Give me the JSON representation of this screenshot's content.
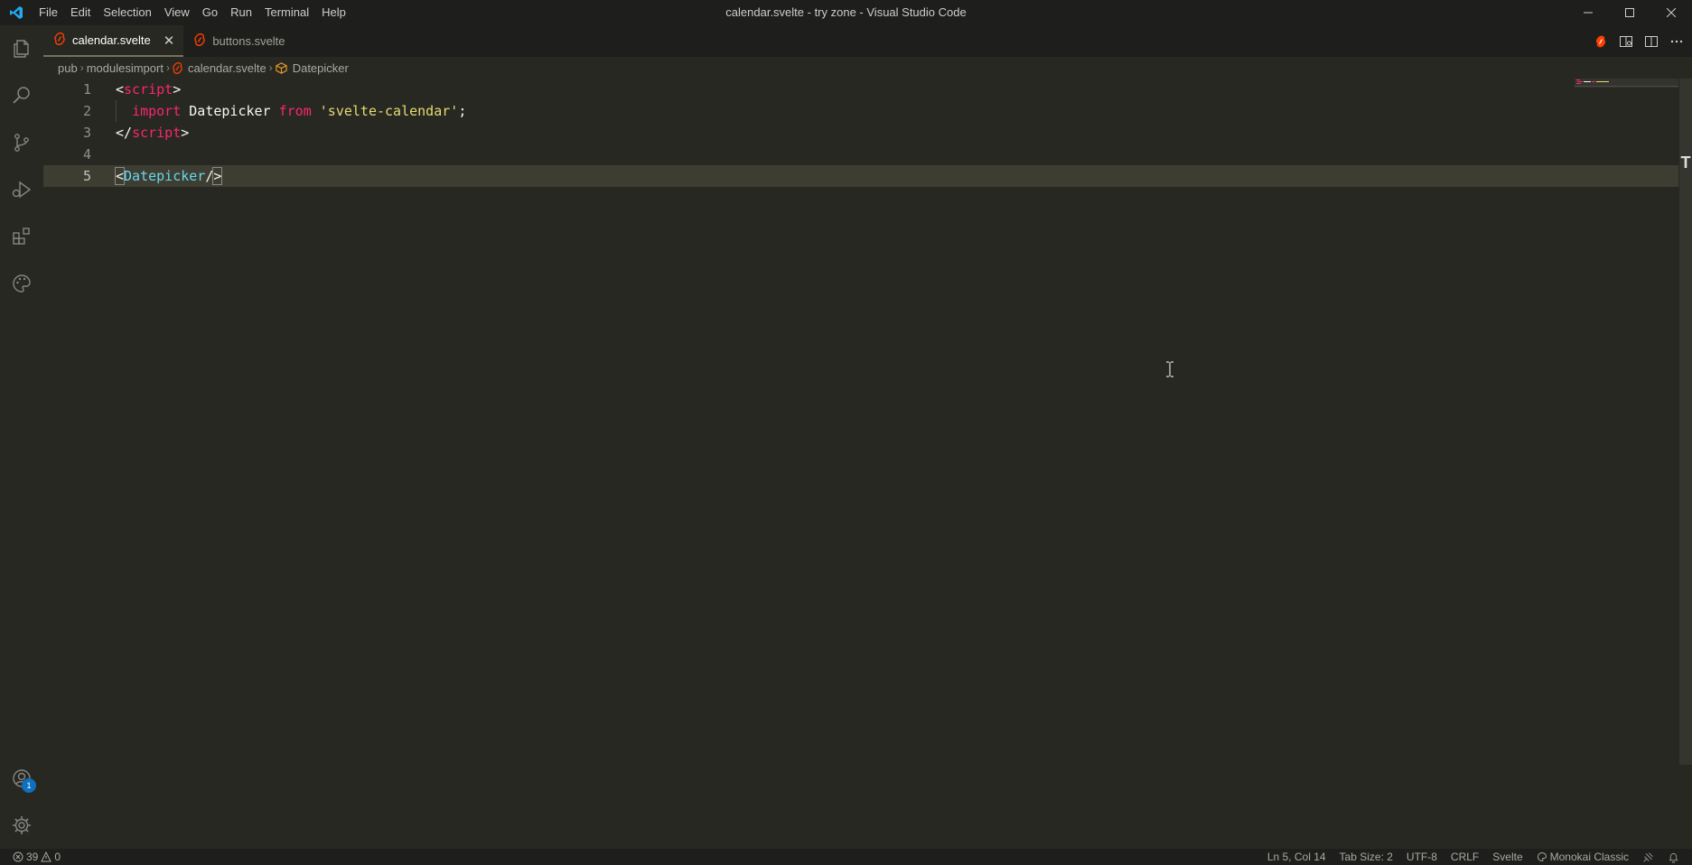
{
  "window": {
    "title": "calendar.svelte - try zone - Visual Studio Code"
  },
  "menu": [
    "File",
    "Edit",
    "Selection",
    "View",
    "Go",
    "Run",
    "Terminal",
    "Help"
  ],
  "tabs": [
    {
      "label": "calendar.svelte",
      "active": true
    },
    {
      "label": "buttons.svelte",
      "active": false
    }
  ],
  "breadcrumb": {
    "items": [
      "pub",
      "modulesimport",
      "calendar.svelte",
      "Datepicker"
    ]
  },
  "editor": {
    "lines": [
      {
        "number": "1"
      },
      {
        "number": "2"
      },
      {
        "number": "3"
      },
      {
        "number": "4"
      },
      {
        "number": "5"
      }
    ],
    "tokens": {
      "l1_open": "<",
      "l1_tag": "script",
      "l1_close": ">",
      "l2_kw1": "import",
      "l2_id": "Datepicker",
      "l2_kw2": "from",
      "l2_str": "'svelte-calendar'",
      "l2_semi": ";",
      "l3_open": "</",
      "l3_tag": "script",
      "l3_close": ">",
      "l5_open": "<",
      "l5_comp": "Datepicker",
      "l5_slash": "/",
      "l5_close": ">"
    }
  },
  "activity_bar": {
    "accounts_badge": "1"
  },
  "status": {
    "errors": "39",
    "warnings": "0",
    "position": "Ln 5, Col 14",
    "tab_size": "Tab Size: 2",
    "encoding": "UTF-8",
    "eol": "CRLF",
    "language": "Svelte",
    "theme": "Monokai Classic"
  },
  "colors": {
    "svelte_orange": "#ff3e00",
    "accent_blue": "#0e70c0",
    "vscode_blue": "#23a9f2"
  }
}
